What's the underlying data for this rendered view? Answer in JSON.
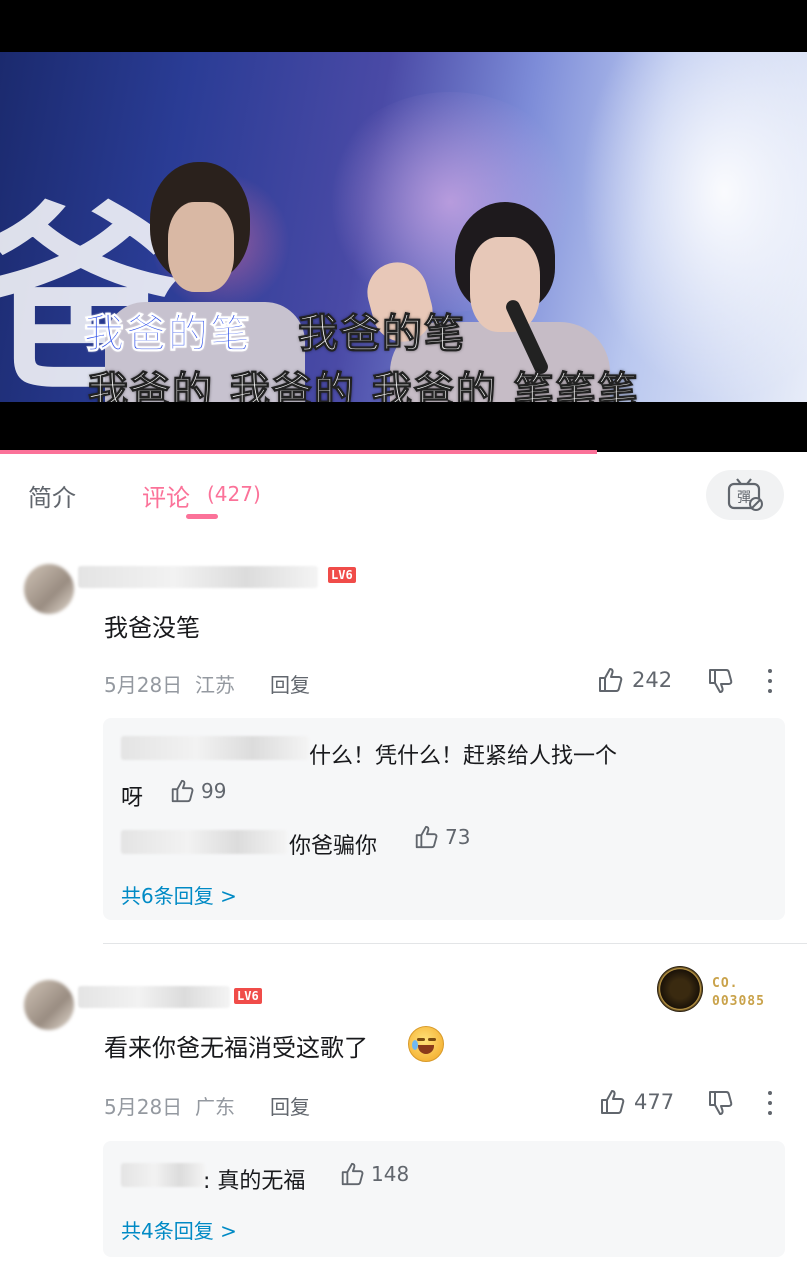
{
  "video": {
    "lyric_line1_highlight": "我爸的笔",
    "lyric_line1_rest": "我爸的笔",
    "lyric_line2": "我爸的 我爸的 我爸的 笔笔笔",
    "background_char": "爸",
    "progress_fraction": 0.74,
    "accent_color": "#fb7299"
  },
  "tabs": {
    "intro_label": "简介",
    "comments_label": "评论",
    "comments_count": "(427)",
    "danmaku_icon": "danmaku-off-icon"
  },
  "comments": [
    {
      "level": "LV6",
      "text": "我爸没笔",
      "date": "5月28日",
      "location": "江苏",
      "reply_label": "回复",
      "likes": "242",
      "replies": [
        {
          "text": "什么！凭什么！赶紧给人找一个",
          "text_line2": "呀",
          "likes": "99"
        },
        {
          "text": "你爸骗你",
          "likes": "73"
        }
      ],
      "view_more": "共6条回复 >"
    },
    {
      "level": "LV6",
      "text": "看来你爸无福消受这歌了",
      "emoji": "crying-laughing-emoji",
      "fan_badge_line1": "CO.",
      "fan_badge_line2": "003085",
      "date": "5月28日",
      "location": "广东",
      "reply_label": "回复",
      "likes": "477",
      "replies": [
        {
          "text": ": 真的无福",
          "likes": "148"
        }
      ],
      "view_more": "共4条回复 >"
    }
  ]
}
